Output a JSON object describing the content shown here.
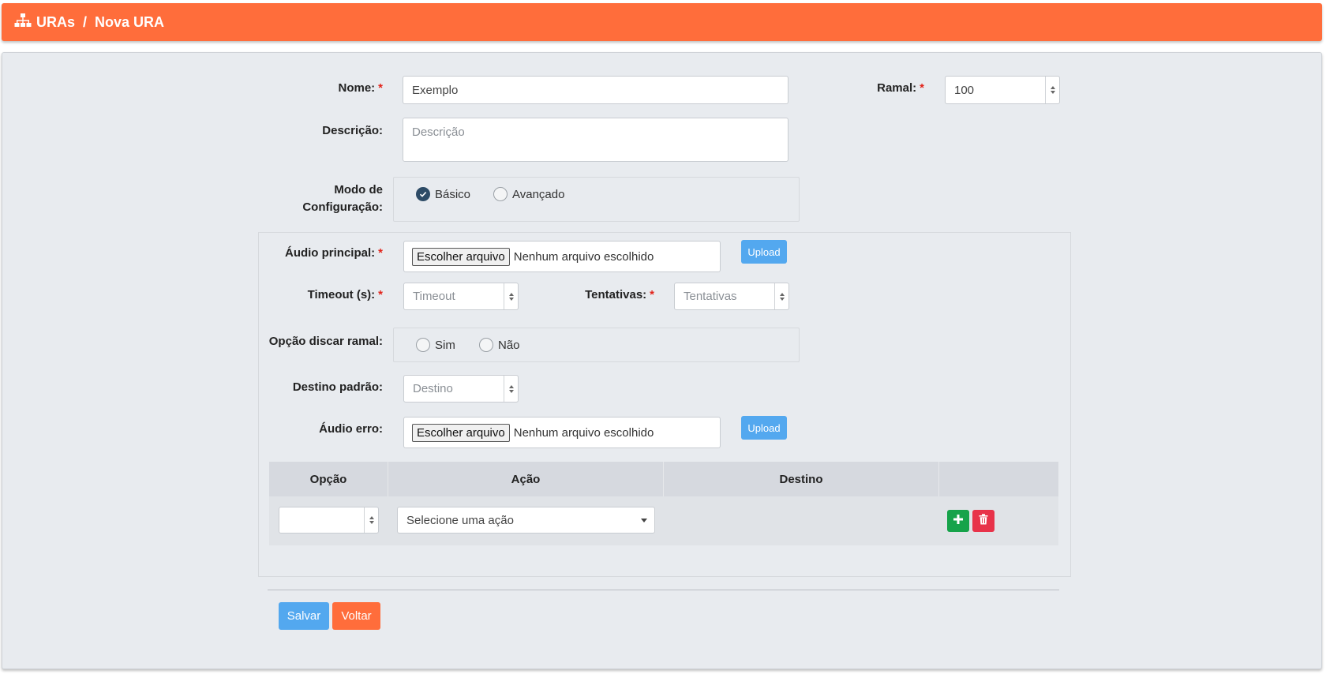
{
  "breadcrumb": {
    "root": "URAs",
    "separator": "/",
    "current": "Nova URA",
    "icon": "sitemap-icon"
  },
  "form": {
    "nome": {
      "label": "Nome:",
      "required": "*",
      "value": "Exemplo"
    },
    "ramal": {
      "label": "Ramal:",
      "required": "*",
      "value": "100"
    },
    "descricao": {
      "label": "Descrição:",
      "placeholder": "Descrição"
    },
    "modo": {
      "label_line1": "Modo de",
      "label_line2": "Configuração:",
      "options": [
        {
          "label": "Básico",
          "checked": true
        },
        {
          "label": "Avançado",
          "checked": false
        }
      ]
    },
    "audio_principal": {
      "label": "Áudio principal:",
      "required": "*",
      "button": "Escolher arquivo",
      "status": "Nenhum arquivo escolhido",
      "upload": "Upload"
    },
    "timeout": {
      "label": "Timeout (s):",
      "required": "*",
      "placeholder": "Timeout"
    },
    "tentativas": {
      "label": "Tentativas:",
      "required": "*",
      "placeholder": "Tentativas"
    },
    "discar_ramal": {
      "label": "Opção discar ramal:",
      "options": [
        {
          "label": "Sim",
          "checked": false
        },
        {
          "label": "Não",
          "checked": false
        }
      ]
    },
    "destino_padrao": {
      "label": "Destino padrão:",
      "placeholder": "Destino"
    },
    "audio_erro": {
      "label": "Áudio erro:",
      "button": "Escolher arquivo",
      "status": "Nenhum arquivo escolhido",
      "upload": "Upload"
    }
  },
  "table": {
    "headers": [
      "Opção",
      "Ação",
      "Destino",
      ""
    ],
    "row": {
      "opcao": "",
      "acao_placeholder": "Selecione uma ação"
    }
  },
  "actions": {
    "save": "Salvar",
    "back": "Voltar"
  },
  "colors": {
    "header": "#ff6d3b",
    "primary": "#53a8ef",
    "success": "#16a34a",
    "danger": "#e8334a",
    "panel": "#e8ebef"
  }
}
